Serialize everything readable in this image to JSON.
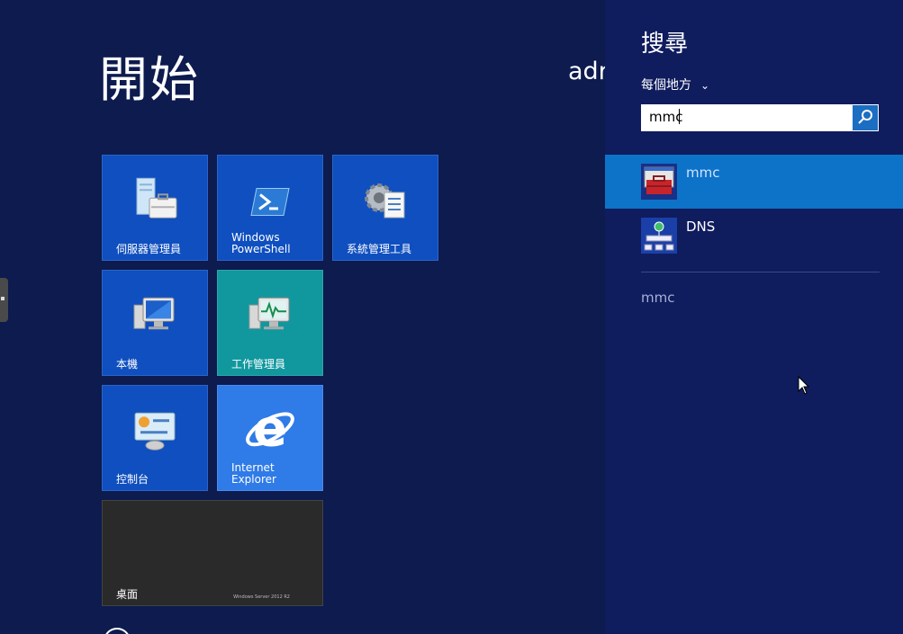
{
  "start": {
    "title": "開始",
    "user": "adr",
    "tiles": [
      {
        "label": "伺服器管理員",
        "icon": "server-manager-icon"
      },
      {
        "label": "Windows\nPowerShell",
        "icon": "powershell-icon"
      },
      {
        "label": "系統管理工具",
        "icon": "admin-tools-icon"
      },
      {
        "label": "本機",
        "icon": "computer-icon"
      },
      {
        "label": "工作管理員",
        "icon": "task-manager-icon"
      },
      {
        "label": "控制台",
        "icon": "control-panel-icon"
      },
      {
        "label": "Internet\nExplorer",
        "icon": "ie-icon"
      },
      {
        "label": "桌面",
        "icon": "desktop-icon",
        "brand": "Windows Server 2012 R2"
      }
    ]
  },
  "search": {
    "title": "搜尋",
    "scope": "每個地方",
    "query": "mmc",
    "results": [
      {
        "label": "mmc",
        "icon": "mmc-toolbox-icon",
        "selected": true
      },
      {
        "label": "DNS",
        "icon": "dns-icon",
        "selected": false
      }
    ],
    "suggestion": "mmc"
  },
  "colors": {
    "background": "#0d1b4f",
    "charm": "#0f1c5e",
    "tile_blue": "#0f4fbf",
    "tile_teal": "#11989e",
    "tile_ie": "#2f7be7",
    "selection": "#0d73c9"
  }
}
